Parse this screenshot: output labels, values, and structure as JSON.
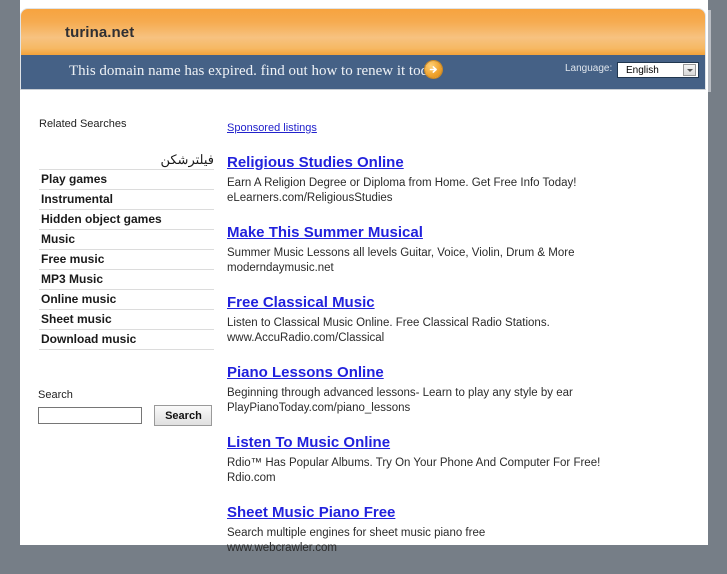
{
  "banner": {
    "domain": "turina.net",
    "message": "This domain name has expired. find out how to renew it today",
    "arrow_icon": "circle-arrow-right-icon",
    "language_label": "Language:",
    "language_value": "English",
    "accent_orange": "#f4a23a",
    "strip_blue": "#456186",
    "page_background": "#767e87"
  },
  "sidebar": {
    "title": "Related Searches",
    "items": [
      {
        "label": "فیلترشکن",
        "rtl": true
      },
      {
        "label": "Play games",
        "rtl": false
      },
      {
        "label": "Instrumental",
        "rtl": false
      },
      {
        "label": "Hidden object games",
        "rtl": false
      },
      {
        "label": "Music",
        "rtl": false
      },
      {
        "label": "Free music",
        "rtl": false
      },
      {
        "label": "MP3 Music",
        "rtl": false
      },
      {
        "label": "Online music",
        "rtl": false
      },
      {
        "label": "Sheet music",
        "rtl": false
      },
      {
        "label": "Download music",
        "rtl": false
      }
    ]
  },
  "search": {
    "label": "Search",
    "value": "",
    "placeholder": "",
    "button_label": "Search"
  },
  "listings": {
    "sponsored_label": "Sponsored listings",
    "link_color": "#2222dd",
    "ads": [
      {
        "title": "Religious Studies Online",
        "description": "Earn A Religion Degree or Diploma from Home. Get Free Info Today!",
        "url": "eLearners.com/ReligiousStudies"
      },
      {
        "title": "Make This Summer Musical",
        "description": "Summer Music Lessons all levels Guitar, Voice, Violin, Drum & More",
        "url": "moderndaymusic.net"
      },
      {
        "title": "Free Classical Music",
        "description": "Listen to Classical Music Online. Free Classical Radio Stations.",
        "url": "www.AccuRadio.com/Classical"
      },
      {
        "title": "Piano Lessons Online",
        "description": "Beginning through advanced lessons- Learn to play any style by ear",
        "url": "PlayPianoToday.com/piano_lessons"
      },
      {
        "title": "Listen To Music Online",
        "description": "Rdio™ Has Popular Albums. Try On Your Phone And Computer For Free!",
        "url": "Rdio.com"
      },
      {
        "title": "Sheet Music Piano Free",
        "description": "Search multiple engines for sheet music piano free",
        "url": "www.webcrawler.com"
      }
    ]
  }
}
